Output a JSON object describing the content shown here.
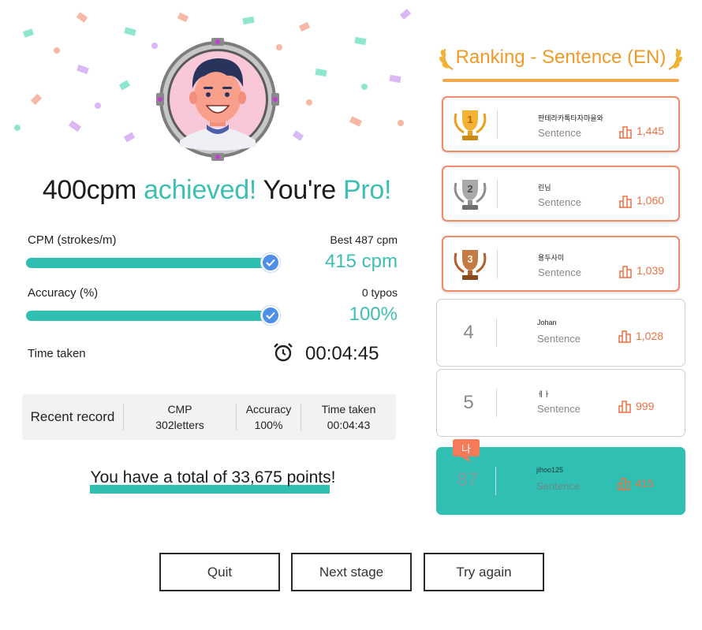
{
  "result": {
    "headline_speed": "400cpm",
    "headline_achieved": "achieved!",
    "headline_youre": "You're",
    "headline_level": "Pro!"
  },
  "cpm": {
    "label": "CPM (strokes/m)",
    "best": "Best 487 cpm",
    "value": "415 cpm",
    "progress": 1.0
  },
  "accuracy": {
    "label": "Accuracy (%)",
    "typos": "0 typos",
    "value": "100%",
    "progress": 1.0
  },
  "time": {
    "label": "Time taken",
    "value": "00:04:45",
    "icon": "alarm-clock-icon"
  },
  "recent": {
    "title": "Recent record",
    "cmp_label": "CMP",
    "cmp_value": "302letters",
    "accuracy_label": "Accuracy",
    "accuracy_value": "100%",
    "time_label": "Time taken",
    "time_value": "00:04:43"
  },
  "points": {
    "text": "You have a total of 33,675 points!"
  },
  "buttons": {
    "quit": "Quit",
    "next": "Next stage",
    "retry": "Try again"
  },
  "ranking": {
    "title": "Ranking - Sentence (EN)",
    "entries": [
      {
        "rank": "1",
        "name": "판테라카톡타자마을와",
        "category": "Sentence",
        "score": "1,445",
        "medal": "gold"
      },
      {
        "rank": "2",
        "name": "린님",
        "category": "Sentence",
        "score": "1,060",
        "medal": "silver"
      },
      {
        "rank": "3",
        "name": "용두사미",
        "category": "Sentence",
        "score": "1,039",
        "medal": "bronze"
      },
      {
        "rank": "4",
        "name": "Johan",
        "category": "Sentence",
        "score": "1,028"
      },
      {
        "rank": "5",
        "name": "ㅔㅏ",
        "category": "Sentence",
        "score": "999"
      }
    ],
    "me": {
      "rank": "87",
      "name": "jihoo125",
      "category": "Sentence",
      "score": "415",
      "badge": "나"
    }
  },
  "colors": {
    "accent": "#3fbfb4",
    "bar": "#2fbfb2",
    "check": "#4e8fe8",
    "ranking_title": "#ef9a2a",
    "score": "#ee7042",
    "medal_border": "#ef8a6a",
    "gold": "#e9a21f",
    "silver": "#8f8f8f",
    "bronze": "#b0602d"
  }
}
